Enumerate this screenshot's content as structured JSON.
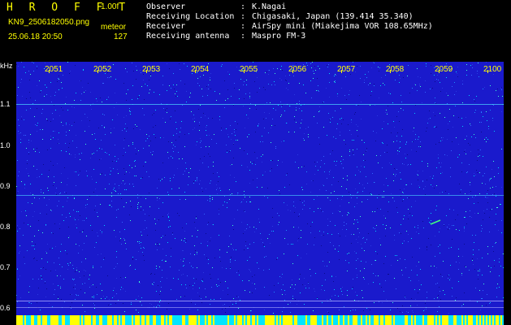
{
  "header": {
    "brand": "H R O F F T",
    "version": "1.00f",
    "filename": "KN9_2506182050.png",
    "mode": "meteor",
    "timestamp": "25.06.18 20:50",
    "count": "127"
  },
  "info": [
    {
      "label": "Observer",
      "value": "K.Nagai"
    },
    {
      "label": "Receiving Location",
      "value": "Chigasaki, Japan (139.414 35.340)"
    },
    {
      "label": "Receiver",
      "value": "AirSpy mini (Miakejima VOR 108.65MHz)"
    },
    {
      "label": "Receiving antenna",
      "value": "Maspro FM-3"
    }
  ],
  "axis": {
    "y_unit": "kHz",
    "y_ticks": [
      "1.1",
      "1.0",
      "0.9",
      "0.8",
      "0.7",
      "0.6"
    ],
    "x_ticks": [
      "2051",
      "2052",
      "2053",
      "2054",
      "2055",
      "2056",
      "2057",
      "2058",
      "2059",
      "2100"
    ]
  },
  "colors": {
    "background": "#1a1acc",
    "header_text": "#ffff00",
    "info_text": "#ffffff",
    "noise_light": "#00e5ff"
  }
}
